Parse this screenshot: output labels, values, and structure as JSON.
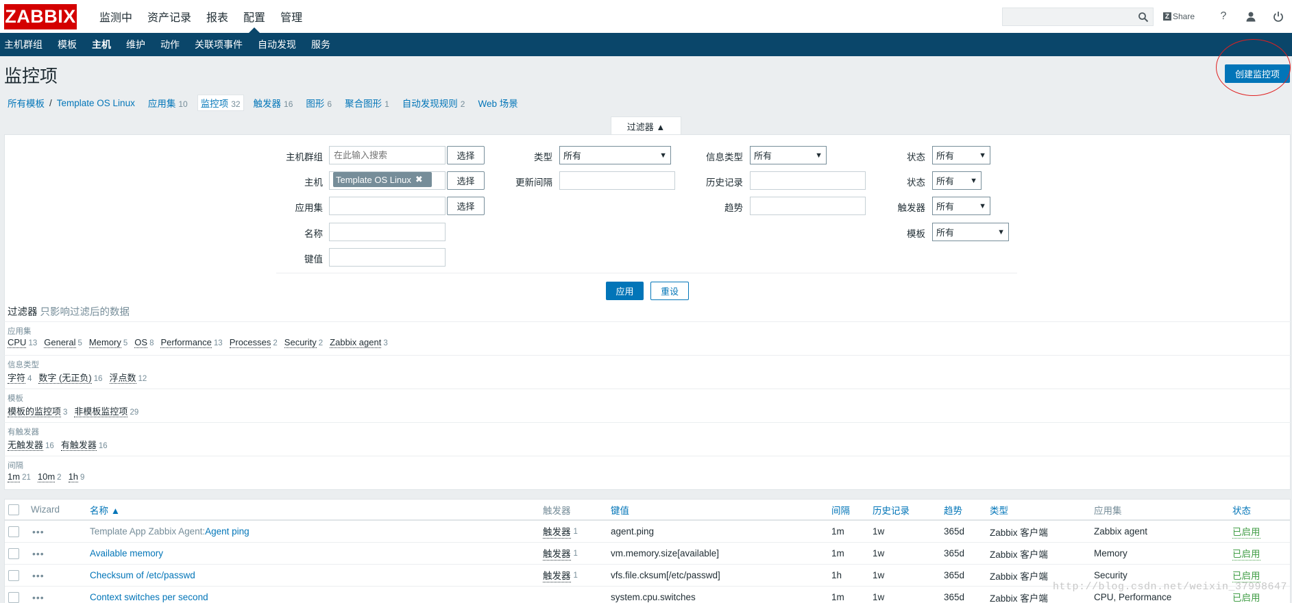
{
  "header": {
    "logo": "ZABBIX",
    "menu": [
      "监测中",
      "资产记录",
      "报表",
      "配置",
      "管理"
    ],
    "active_menu": "配置",
    "search_placeholder": "",
    "share_label": "Share",
    "help_label": "?"
  },
  "subnav": {
    "items": [
      "主机群组",
      "模板",
      "主机",
      "维护",
      "动作",
      "关联项事件",
      "自动发现",
      "服务"
    ],
    "active": "主机"
  },
  "page": {
    "title": "监控项",
    "create_button": "创建监控项"
  },
  "breadcrumbs": {
    "all_templates": "所有模板",
    "separator": "/",
    "template": "Template OS Linux",
    "tabs": [
      {
        "label": "应用集",
        "count": "10"
      },
      {
        "label": "监控项",
        "count": "32"
      },
      {
        "label": "触发器",
        "count": "16"
      },
      {
        "label": "图形",
        "count": "6"
      },
      {
        "label": "聚合图形",
        "count": "1"
      },
      {
        "label": "自动发现规则",
        "count": "2"
      },
      {
        "label": "Web 场景",
        "count": ""
      }
    ]
  },
  "filter": {
    "tab_label": "过滤器 ▲",
    "host_group_label": "主机群组",
    "host_group_placeholder": "在此输入搜索",
    "select_label": "选择",
    "host_label": "主机",
    "host_value": "Template OS Linux",
    "app_label": "应用集",
    "name_label": "名称",
    "key_label": "键值",
    "type_label": "类型",
    "type_value": "所有",
    "interval_label": "更新间隔",
    "info_type_label": "信息类型",
    "info_type_value": "所有",
    "history_label": "历史记录",
    "trend_label": "趋势",
    "status_label": "状态",
    "status_value": "所有",
    "state_label": "状态",
    "state_value": "所有",
    "trigger_label": "触发器",
    "trigger_value": "所有",
    "template_label": "模板",
    "template_value": "所有",
    "apply": "应用",
    "reset": "重设"
  },
  "subfilter": {
    "title": "过滤器",
    "hint": "只影响过滤后的数据",
    "groups": [
      {
        "head": "应用集",
        "values": [
          {
            "name": "CPU",
            "count": "13"
          },
          {
            "name": "General",
            "count": "5"
          },
          {
            "name": "Memory",
            "count": "5"
          },
          {
            "name": "OS",
            "count": "8"
          },
          {
            "name": "Performance",
            "count": "13"
          },
          {
            "name": "Processes",
            "count": "2"
          },
          {
            "name": "Security",
            "count": "2"
          },
          {
            "name": "Zabbix agent",
            "count": "3"
          }
        ]
      },
      {
        "head": "信息类型",
        "values": [
          {
            "name": "字符",
            "count": "4"
          },
          {
            "name": "数字 (无正负)",
            "count": "16"
          },
          {
            "name": "浮点数",
            "count": "12"
          }
        ]
      },
      {
        "head": "模板",
        "values": [
          {
            "name": "模板的监控项",
            "count": "3"
          },
          {
            "name": "非模板监控项",
            "count": "29"
          }
        ]
      },
      {
        "head": "有触发器",
        "values": [
          {
            "name": "无触发器",
            "count": "16"
          },
          {
            "name": "有触发器",
            "count": "16"
          }
        ]
      },
      {
        "head": "间隔",
        "values": [
          {
            "name": "1m",
            "count": "21"
          },
          {
            "name": "10m",
            "count": "2"
          },
          {
            "name": "1h",
            "count": "9"
          }
        ]
      }
    ]
  },
  "table": {
    "headers": {
      "wizard": "Wizard",
      "name": "名称 ▲",
      "triggers": "触发器",
      "key": "键值",
      "interval": "间隔",
      "history": "历史记录",
      "trends": "趋势",
      "type": "类型",
      "applications": "应用集",
      "status": "状态"
    },
    "rows": [
      {
        "template": "Template App Zabbix Agent: ",
        "name": "Agent ping",
        "trig": "触发器",
        "trig_count": "1",
        "key": "agent.ping",
        "interval": "1m",
        "history": "1w",
        "trends": "365d",
        "type": "Zabbix 客户端",
        "apps": "Zabbix agent",
        "status": "已启用"
      },
      {
        "template": "",
        "name": "Available memory",
        "trig": "触发器",
        "trig_count": "1",
        "key": "vm.memory.size[available]",
        "interval": "1m",
        "history": "1w",
        "trends": "365d",
        "type": "Zabbix 客户端",
        "apps": "Memory",
        "status": "已启用"
      },
      {
        "template": "",
        "name": "Checksum of /etc/passwd",
        "trig": "触发器",
        "trig_count": "1",
        "key": "vfs.file.cksum[/etc/passwd]",
        "interval": "1h",
        "history": "1w",
        "trends": "365d",
        "type": "Zabbix 客户端",
        "apps": "Security",
        "status": "已启用"
      },
      {
        "template": "",
        "name": "Context switches per second",
        "trig": "",
        "trig_count": "",
        "key": "system.cpu.switches",
        "interval": "1m",
        "history": "1w",
        "trends": "365d",
        "type": "Zabbix 客户端",
        "apps": "CPU, Performance",
        "status": "已启用"
      }
    ]
  },
  "watermark": "http://blog.csdn.net/weixin_37998647"
}
